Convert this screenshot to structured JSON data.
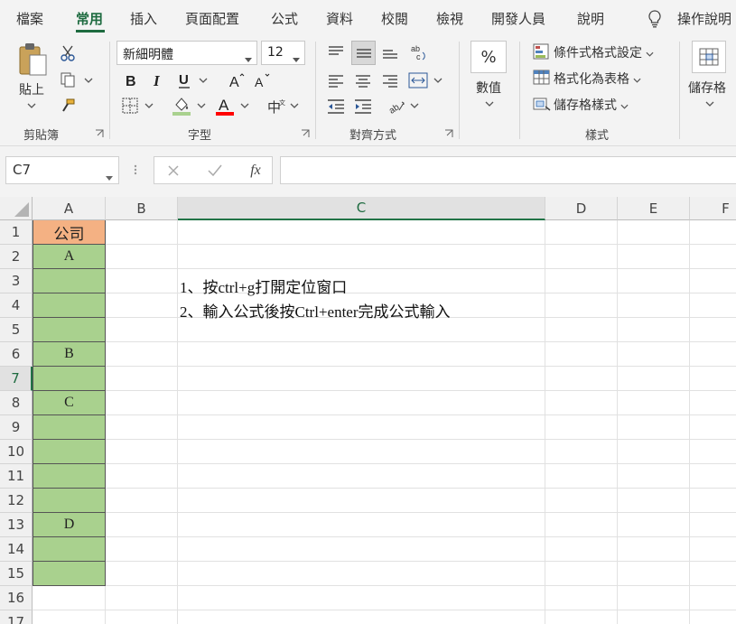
{
  "menu": {
    "tabs": [
      "檔案",
      "常用",
      "插入",
      "頁面配置",
      "公式",
      "資料",
      "校閱",
      "檢視",
      "開發人員",
      "說明"
    ],
    "tell_me": "操作說明"
  },
  "ribbon": {
    "clipboard": {
      "paste_label": "貼上",
      "group_label": "剪貼簿"
    },
    "font": {
      "font_name": "新細明體",
      "font_size": "12",
      "group_label": "字型",
      "font_color": "#ff0000",
      "fill_color": "#ffff00"
    },
    "alignment": {
      "group_label": "對齊方式"
    },
    "number": {
      "percent_symbol": "%",
      "label": "數值"
    },
    "styles": {
      "conditional_formatting": "條件式格式設定",
      "format_as_table": "格式化為表格",
      "cell_styles": "儲存格樣式",
      "group_label": "樣式"
    },
    "cells": {
      "label": "儲存格"
    }
  },
  "formula_bar": {
    "name_box": "C7",
    "fx": "fx",
    "formula": ""
  },
  "sheet": {
    "columns": [
      "A",
      "B",
      "C",
      "D",
      "E",
      "F"
    ],
    "selected_column": "C",
    "rows": [
      "1",
      "2",
      "3",
      "4",
      "5",
      "6",
      "7",
      "8",
      "9",
      "10",
      "11",
      "12",
      "13",
      "14",
      "15",
      "16",
      "17"
    ],
    "selected_row": "7",
    "colA": [
      "公司",
      "A",
      "",
      "",
      "",
      "B",
      "",
      "C",
      "",
      "",
      "",
      "",
      "D",
      "",
      ""
    ],
    "notes": {
      "line1": "1、按ctrl+g打開定位窗口",
      "line2": "2、輸入公式後按Ctrl+enter完成公式輸入"
    },
    "colors": {
      "header_fill": "#f4b183",
      "data_fill": "#a9d18e",
      "accent": "#217346"
    }
  }
}
